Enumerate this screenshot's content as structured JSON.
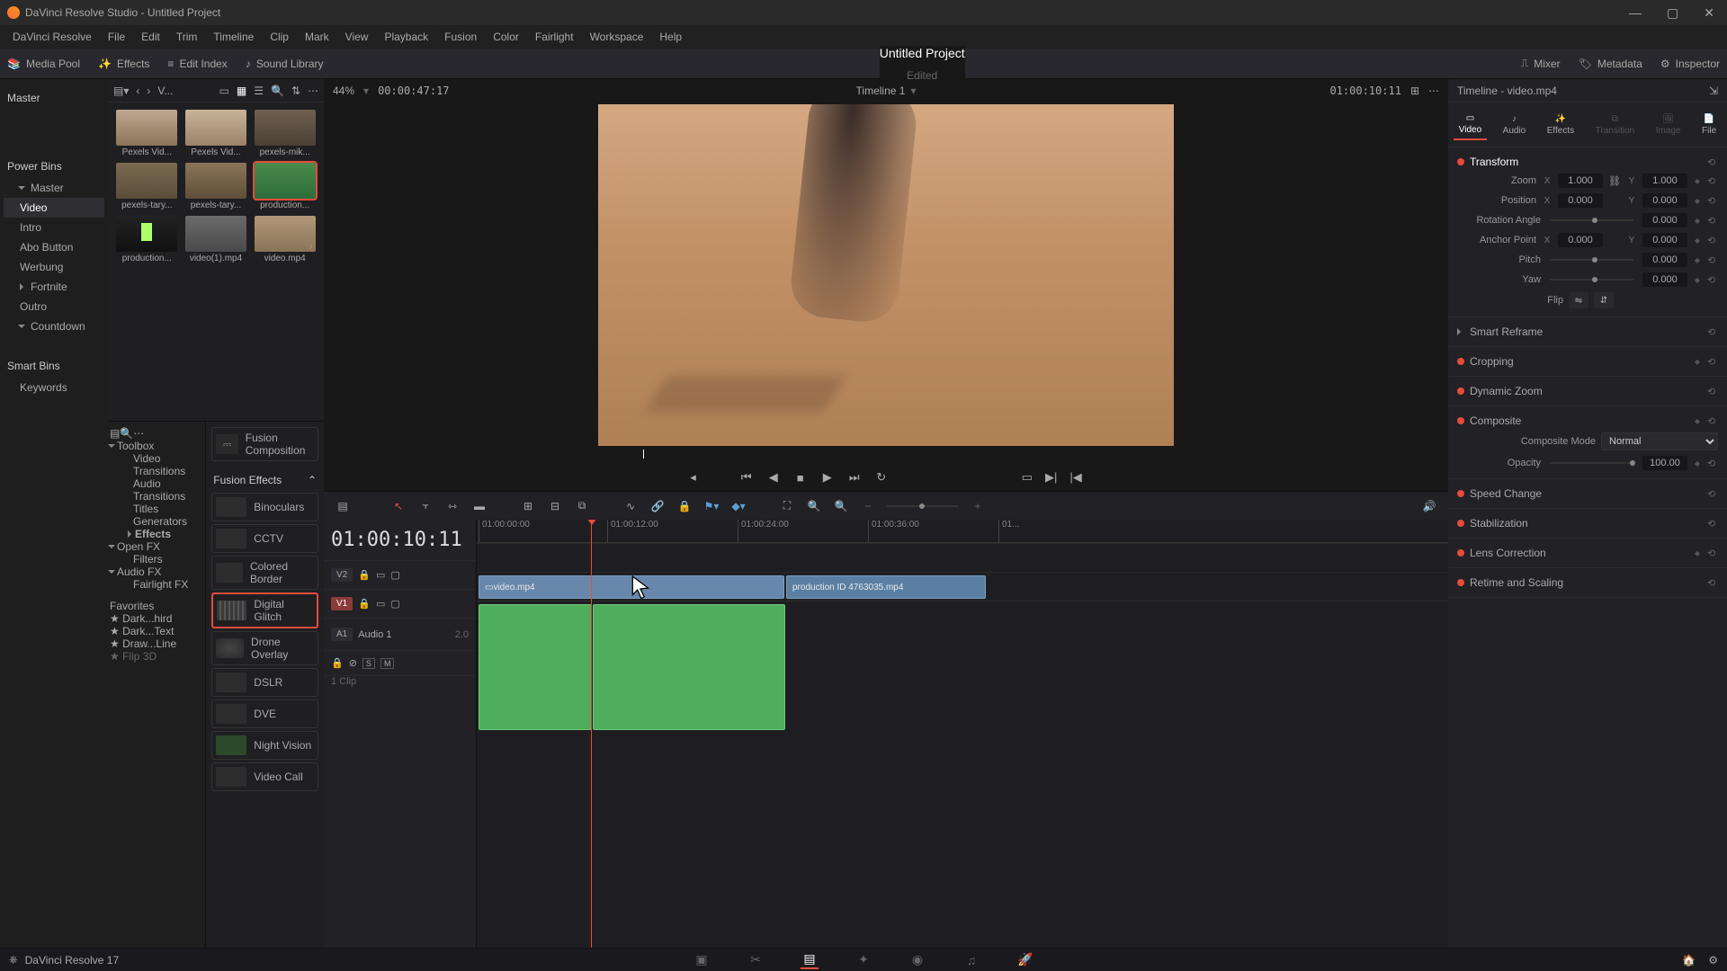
{
  "window": {
    "title": "DaVinci Resolve Studio - Untitled Project"
  },
  "menu": [
    "DaVinci Resolve",
    "File",
    "Edit",
    "Trim",
    "Timeline",
    "Clip",
    "Mark",
    "View",
    "Playback",
    "Fusion",
    "Color",
    "Fairlight",
    "Workspace",
    "Help"
  ],
  "toolbar": {
    "mediaPool": "Media Pool",
    "effects": "Effects",
    "editIndex": "Edit Index",
    "soundLibrary": "Sound Library",
    "projectTitle": "Untitled Project",
    "projectState": "Edited",
    "mixer": "Mixer",
    "metadata": "Metadata",
    "inspector": "Inspector"
  },
  "bins": {
    "master": "Master",
    "powerBins": "Power Bins",
    "items": [
      "Master",
      "Video",
      "Intro",
      "Abo Button",
      "Werbung",
      "Fortnite",
      "Outro",
      "Countdown"
    ],
    "smartBins": "Smart Bins",
    "keywords": "Keywords"
  },
  "mp": {
    "sort": "V...",
    "clips": [
      "Pexels Vid...",
      "Pexels Vid...",
      "pexels-mik...",
      "pexels-tary...",
      "pexels-tary...",
      "production...",
      "production...",
      "video(1).mp4",
      "video.mp4"
    ]
  },
  "fxCats": {
    "toolbox": "Toolbox",
    "items": [
      "Video Transitions",
      "Audio Transitions",
      "Titles",
      "Generators",
      "Effects",
      "Open FX",
      "Filters",
      "Audio FX",
      "Fairlight FX"
    ],
    "favorites": "Favorites",
    "favs": [
      "Dark...hird",
      "Dark...Text",
      "Draw...Line",
      "Flip 3D"
    ]
  },
  "fxlist": {
    "fusionComp": "Fusion Composition",
    "head": "Fusion Effects",
    "items": [
      "Binoculars",
      "CCTV",
      "Colored Border",
      "Digital Glitch",
      "Drone Overlay",
      "DSLR",
      "DVE",
      "Night Vision",
      "Video Call"
    ]
  },
  "viewer": {
    "zoom": "44%",
    "sourceTC": "00:00:47:17",
    "timelineName": "Timeline 1",
    "recordTC": "01:00:10:11"
  },
  "timeline": {
    "tc": "01:00:10:11",
    "ticks": [
      "01:00:00:00",
      "01:00:12:00",
      "01:00:24:00",
      "01:00:36:00",
      "01..."
    ],
    "tracks": {
      "v2": "V2",
      "v1": "V1",
      "a1": "A1",
      "audio1": "Audio 1",
      "clipcount": "1 Clip",
      "two": "2.0"
    },
    "clips": {
      "video": "video.mp4",
      "prod": "production ID 4763035.mp4"
    }
  },
  "inspector": {
    "header": "Timeline - video.mp4",
    "tabs": [
      "Video",
      "Audio",
      "Effects",
      "Transition",
      "Image",
      "File"
    ],
    "transform": {
      "title": "Transform",
      "zoom": "Zoom",
      "zoomX": "1.000",
      "zoomY": "1.000",
      "position": "Position",
      "posX": "0.000",
      "posY": "0.000",
      "rotation": "Rotation Angle",
      "rotVal": "0.000",
      "anchor": "Anchor Point",
      "anchX": "0.000",
      "anchY": "0.000",
      "pitch": "Pitch",
      "pitchVal": "0.000",
      "yaw": "Yaw",
      "yawVal": "0.000",
      "flip": "Flip"
    },
    "sections": {
      "smartReframe": "Smart Reframe",
      "cropping": "Cropping",
      "dynamicZoom": "Dynamic Zoom",
      "composite": "Composite",
      "compositeMode": "Composite Mode",
      "compositeVal": "Normal",
      "opacity": "Opacity",
      "opacityVal": "100.00",
      "speedChange": "Speed Change",
      "stabilization": "Stabilization",
      "lensCorrection": "Lens Correction",
      "retime": "Retime and Scaling"
    }
  },
  "footer": {
    "version": "DaVinci Resolve 17"
  }
}
